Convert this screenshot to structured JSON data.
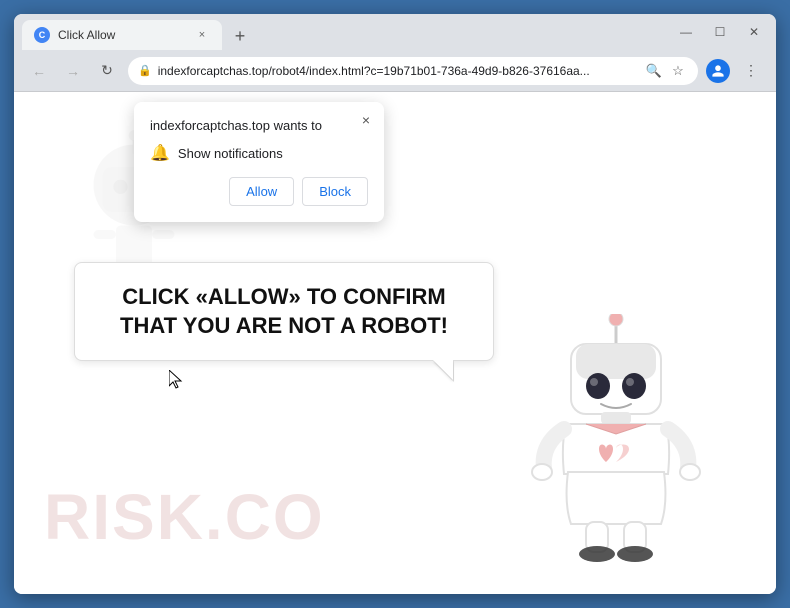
{
  "browser": {
    "title": "Click Allow",
    "tab": {
      "favicon": "C",
      "title": "Click Allow",
      "close_label": "×"
    },
    "new_tab_label": "+",
    "window_controls": {
      "minimize": "—",
      "maximize": "☐",
      "close": "✕"
    },
    "address_bar": {
      "back_label": "←",
      "forward_label": "→",
      "reload_label": "↻",
      "url": "indexforcaptchas.top/robot4/index.html?c=19b71b01-736a-49d9-b826-37616aa...",
      "lock_icon": "🔒",
      "search_icon": "🔍",
      "star_icon": "☆",
      "menu_icon": "⋮"
    }
  },
  "notification_popup": {
    "title": "indexforcaptchas.top wants to",
    "close_label": "×",
    "bell_icon": "🔔",
    "permission_text": "Show notifications",
    "allow_label": "Allow",
    "block_label": "Block"
  },
  "speech_bubble": {
    "text": "CLICK «ALLOW» TO CONFIRM THAT YOU ARE NOT A ROBOT!"
  },
  "watermark": {
    "text": "RISK.CO"
  }
}
